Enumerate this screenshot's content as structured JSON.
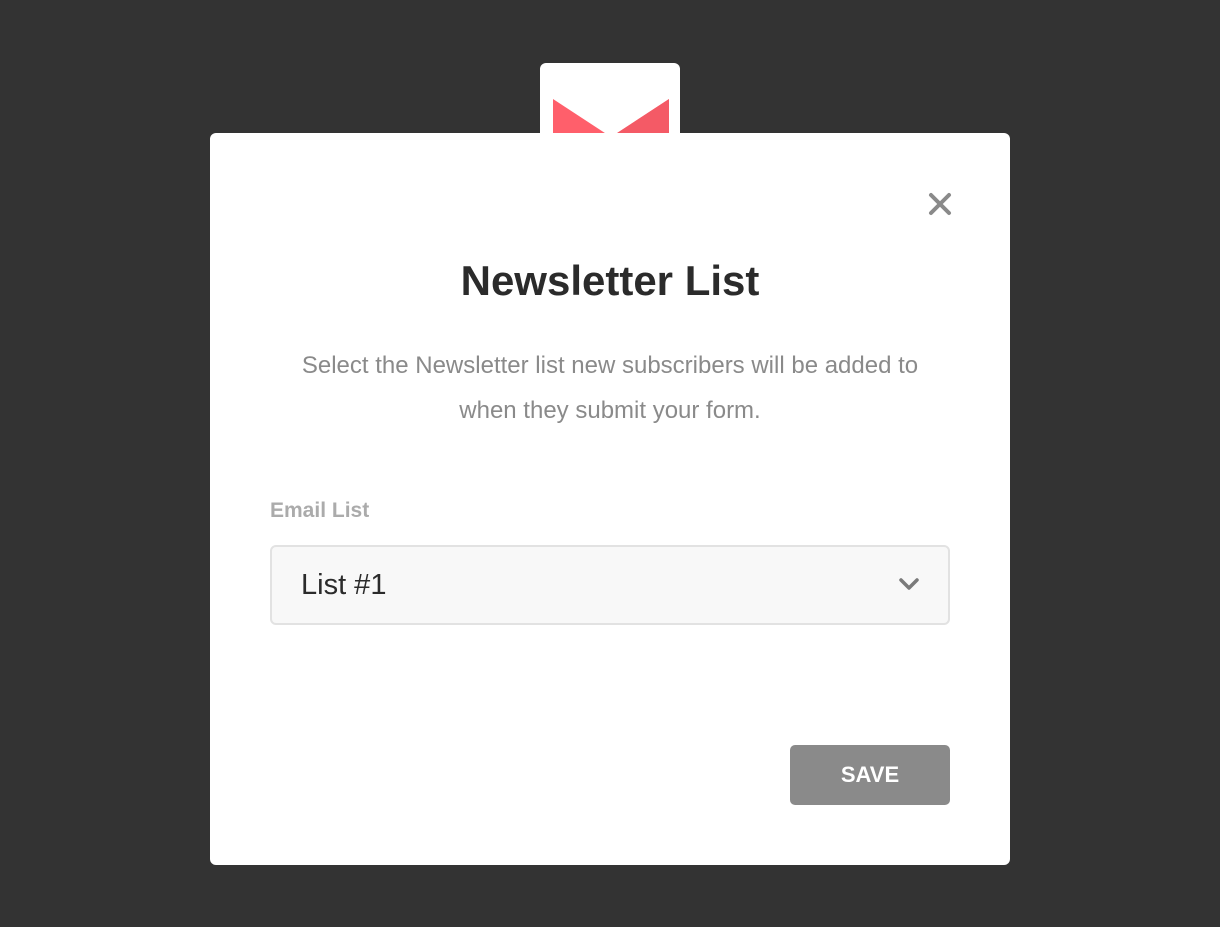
{
  "header_icon": {
    "name": "envelope-icon",
    "color": "#ff5a67"
  },
  "modal": {
    "close_icon": "close-icon",
    "title": "Newsletter List",
    "description": "Select the Newsletter list new subscribers will be added to when they submit your form."
  },
  "email_list_field": {
    "label": "Email List",
    "selected_value": "List #1",
    "dropdown_icon": "chevron-down-icon"
  },
  "save_button": {
    "label": "SAVE",
    "color": "#8a8a8a"
  },
  "colors": {
    "backdrop": "#333333",
    "accent": "#ff5a67"
  }
}
